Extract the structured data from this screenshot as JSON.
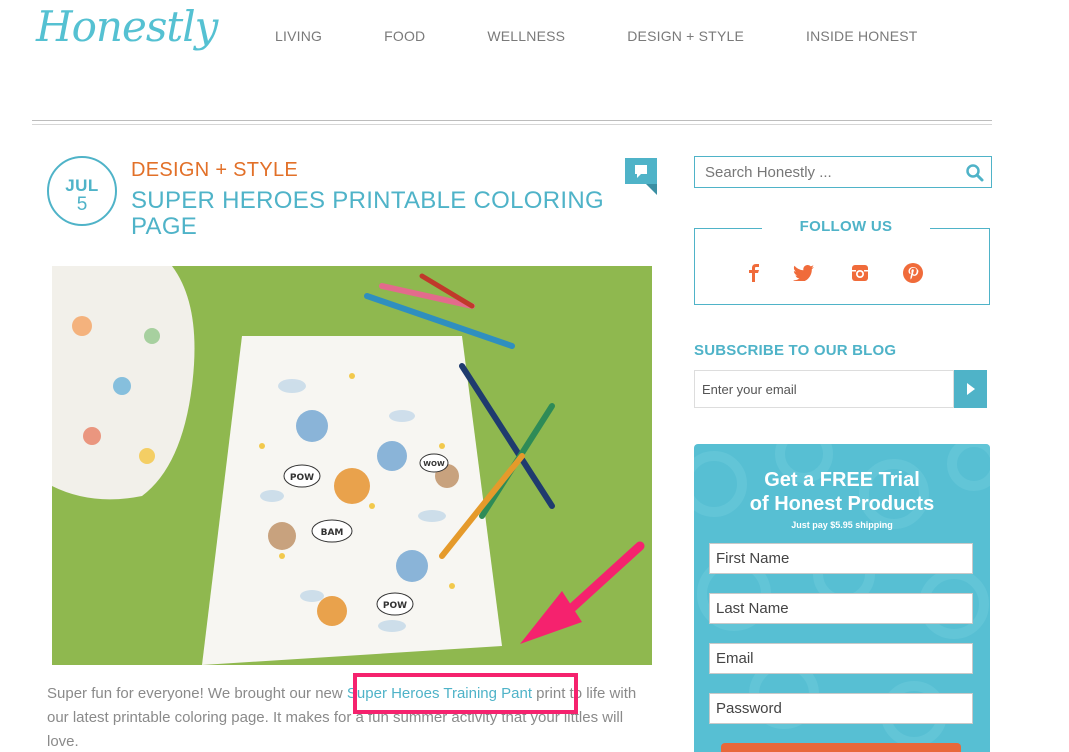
{
  "header": {
    "logo_text": "Honestly",
    "nav": [
      "LIVING",
      "FOOD",
      "WELLNESS",
      "DESIGN + STYLE",
      "INSIDE HONEST"
    ]
  },
  "post": {
    "date_month": "JUL",
    "date_day": "5",
    "category": "DESIGN + STYLE",
    "title": "SUPER HEROES PRINTABLE COLORING PAGE",
    "body_before_link": "Super fun for everyone! We brought our new ",
    "link_text": "Super Heroes Training Pant",
    "body_after_link": " print to life with our latest printable coloring page. It makes for a fun summer activity that your littles will love.",
    "hero_image_labels": [
      "BAM",
      "POW",
      "WOW"
    ]
  },
  "sidebar": {
    "search": {
      "placeholder": "Search Honestly ..."
    },
    "follow_title": "FOLLOW US",
    "social_icons": [
      "facebook-icon",
      "twitter-icon",
      "instagram-icon",
      "pinterest-icon"
    ],
    "subscribe_title": "SUBSCRIBE TO OUR BLOG",
    "subscribe_placeholder": "Enter your email",
    "trial": {
      "title_line1": "Get a FREE Trial",
      "title_line2": "of Honest Products",
      "subtitle": "Just pay $5.95 shipping",
      "fields": [
        "First Name",
        "Last Name",
        "Email",
        "Password"
      ]
    }
  },
  "colors": {
    "brand_teal": "#4fb3c8",
    "category_orange": "#e27028",
    "highlight_pink": "#f5226e",
    "hero_green": "#8fb84f"
  }
}
